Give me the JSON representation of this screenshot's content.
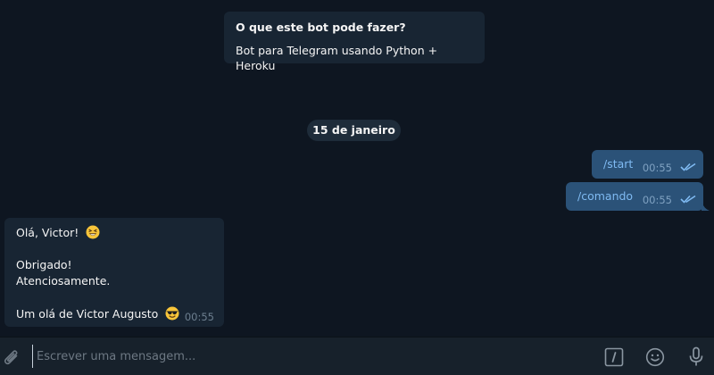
{
  "bot_info": {
    "title": "O que este bot pode fazer?",
    "description": "Bot para Telegram usando Python + Heroku"
  },
  "date_separator": "15 de janeiro",
  "outgoing": [
    {
      "text": "/start",
      "time": "00:55",
      "status": "read"
    },
    {
      "text": "/comando",
      "time": "00:55",
      "status": "read"
    }
  ],
  "incoming": {
    "line1": "Olá, Victor!",
    "line2": "Obrigado!",
    "line3": "Atenciosamente.",
    "line4": "Um olá de Victor Augusto",
    "time": "00:55",
    "emoji1": "grinning-squinting-face",
    "emoji2": "smiling-face-with-sunglasses"
  },
  "composer": {
    "placeholder": "Escrever uma mensagem...",
    "attach_icon": "paperclip-icon",
    "commands_icon": "slash-commands-icon",
    "emoji_icon": "smiley-icon",
    "mic_icon": "microphone-icon"
  },
  "colors": {
    "background": "#0e1621",
    "incoming_bubble": "#182533",
    "outgoing_bubble": "#2b5278",
    "composer": "#17212b",
    "accent": "#7fbaf2"
  }
}
